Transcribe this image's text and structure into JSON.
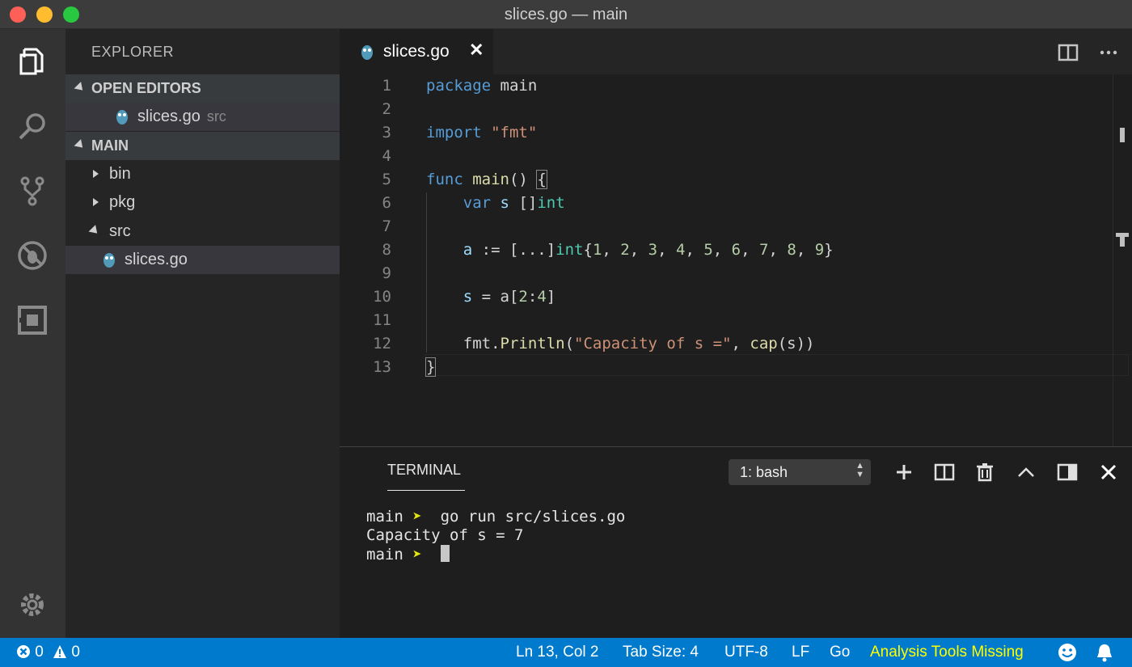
{
  "window": {
    "title": "slices.go — main"
  },
  "sidebar": {
    "title": "EXPLORER",
    "open_editors_label": "OPEN EDITORS",
    "open_editor": {
      "name": "slices.go",
      "folder": "src"
    },
    "main_label": "MAIN",
    "tree": {
      "bin": "bin",
      "pkg": "pkg",
      "src": "src",
      "file": "slices.go"
    }
  },
  "tab": {
    "label": "slices.go",
    "close": "✕"
  },
  "editor": {
    "line_numbers": [
      "1",
      "2",
      "3",
      "4",
      "5",
      "6",
      "7",
      "8",
      "9",
      "10",
      "11",
      "12",
      "13"
    ]
  },
  "panel": {
    "tab": "TERMINAL",
    "shell_select": "1: bash",
    "lines": {
      "l1_prompt": "main",
      "l1_cmd": "go run src/slices.go",
      "l2": "Capacity of s = 7",
      "l3_prompt": "main",
      "arrow": "➤"
    }
  },
  "status": {
    "errors": "0",
    "warnings": "0",
    "position": "Ln 13, Col 2",
    "tab_size": "Tab Size: 4",
    "encoding": "UTF-8",
    "eol": "LF",
    "language": "Go",
    "analysis": "Analysis Tools Missing"
  },
  "colors": {
    "statusbar": "#007acc",
    "activitybar": "#333333",
    "sidebar": "#252526",
    "editor": "#1e1e1e",
    "warning_text": "#ffff00"
  },
  "icons": {
    "activity": [
      "files-icon",
      "search-icon",
      "source-control-icon",
      "debug-icon",
      "extensions-icon",
      "settings-gear-icon"
    ],
    "editor_actions": [
      "split-editor-icon",
      "more-actions-icon"
    ],
    "panel_actions": [
      "add-terminal-icon",
      "split-terminal-icon",
      "trash-icon",
      "maximize-panel-icon",
      "toggle-panel-icon",
      "close-panel-icon"
    ],
    "status": [
      "error-icon",
      "warning-icon",
      "smiley-icon",
      "bell-icon"
    ]
  }
}
